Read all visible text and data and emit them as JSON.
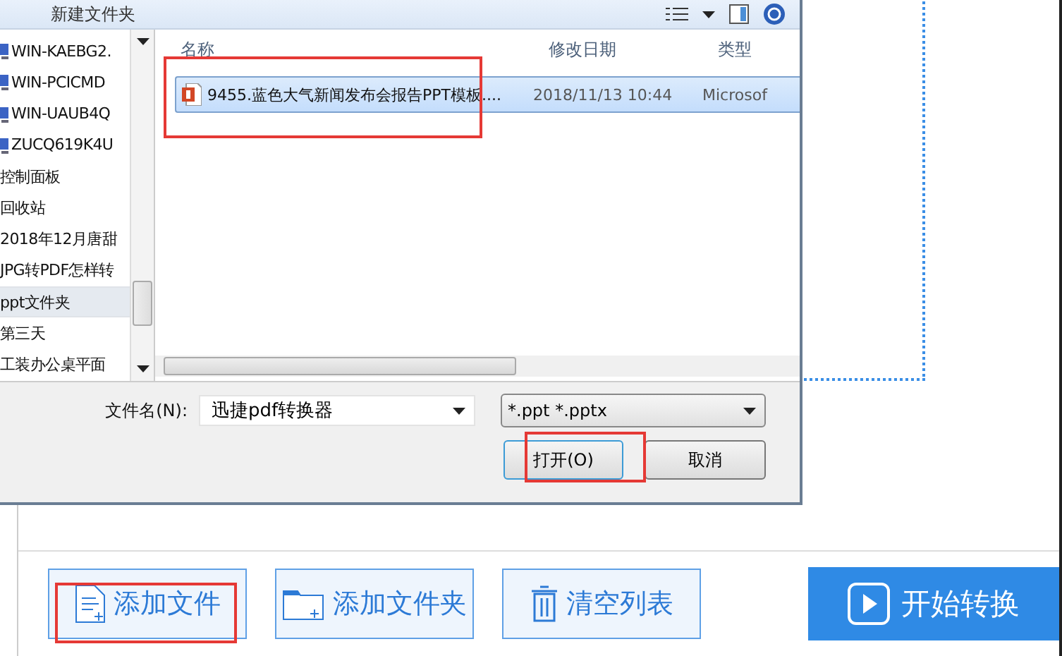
{
  "dialog": {
    "toolbar": {
      "new_folder": "新建文件夹"
    },
    "sidebar": {
      "items": [
        {
          "label": "WIN-KAEBG2.",
          "kind": "computer",
          "selected": false
        },
        {
          "label": "WIN-PCICMD",
          "kind": "computer",
          "selected": false
        },
        {
          "label": "WIN-UAUB4Q",
          "kind": "computer",
          "selected": false
        },
        {
          "label": "ZUCQ619K4U",
          "kind": "computer",
          "selected": false
        },
        {
          "label": "控制面板",
          "kind": "folder",
          "selected": false
        },
        {
          "label": "回收站",
          "kind": "folder",
          "selected": false
        },
        {
          "label": "2018年12月唐甜",
          "kind": "folder",
          "selected": false
        },
        {
          "label": "JPG转PDF怎样转",
          "kind": "folder",
          "selected": false
        },
        {
          "label": "ppt文件夹",
          "kind": "folder",
          "selected": true
        },
        {
          "label": "第三天",
          "kind": "folder",
          "selected": false
        },
        {
          "label": "工装办公桌平面",
          "kind": "folder",
          "selected": false
        }
      ]
    },
    "table": {
      "columns": [
        "名称",
        "修改日期",
        "类型"
      ],
      "rows": [
        {
          "name": "9455.蓝色大气新闻发布会报告PPT模板....",
          "date": "2018/11/13 10:44",
          "type": "Microsof",
          "selected": true
        }
      ]
    },
    "filename": {
      "label": "文件名(N):",
      "value": "迅捷pdf转换器"
    },
    "filter": {
      "value": "*.ppt *.pptx"
    },
    "buttons": [
      {
        "label": "打开(O)",
        "kind": "primary"
      },
      {
        "label": "取消",
        "kind": "normal"
      }
    ]
  },
  "toolbar": {
    "buttons": [
      {
        "label": "添加文件",
        "kind": "file"
      },
      {
        "label": "添加文件夹",
        "kind": "folder"
      },
      {
        "label": "清空列表",
        "kind": "trash"
      }
    ],
    "start": {
      "label": "开始转换"
    }
  }
}
